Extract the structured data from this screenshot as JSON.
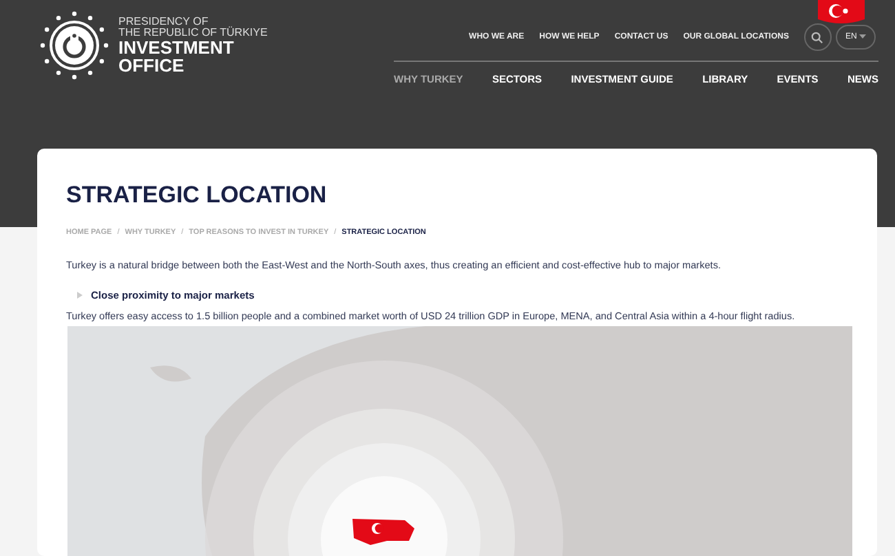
{
  "header": {
    "logo_lines": [
      "PRESIDENCY OF",
      "THE REPUBLIC OF TÜRKIYE",
      "INVESTMENT",
      "OFFICE"
    ],
    "top_links": [
      "WHO WE ARE",
      "HOW WE HELP",
      "CONTACT US",
      "OUR GLOBAL LOCATIONS"
    ],
    "language": "EN",
    "nav": [
      {
        "label": "WHY TURKEY",
        "selected": true
      },
      {
        "label": "SECTORS",
        "selected": false
      },
      {
        "label": "INVESTMENT GUIDE",
        "selected": false
      },
      {
        "label": "LIBRARY",
        "selected": false
      },
      {
        "label": "EVENTS",
        "selected": false
      },
      {
        "label": "NEWS",
        "selected": false
      }
    ]
  },
  "page": {
    "title": "STRATEGIC LOCATION",
    "breadcrumb_separator": "/",
    "breadcrumb": [
      {
        "label": "HOME PAGE",
        "selected": false
      },
      {
        "label": "WHY TURKEY",
        "selected": false
      },
      {
        "label": "TOP REASONS TO INVEST IN TURKEY",
        "selected": false
      },
      {
        "label": "STRATEGIC LOCATION",
        "selected": true
      }
    ],
    "intro": "Turkey is a natural bridge between both the East-West and the North-South axes, thus creating an efficient and cost-effective hub to major markets.",
    "bullet": "Close proximity to major markets",
    "body": "Turkey offers easy access to 1.5 billion people and a combined market worth of USD 24 trillion GDP in Europe, MENA, and Central Asia within a 4-hour flight radius."
  }
}
